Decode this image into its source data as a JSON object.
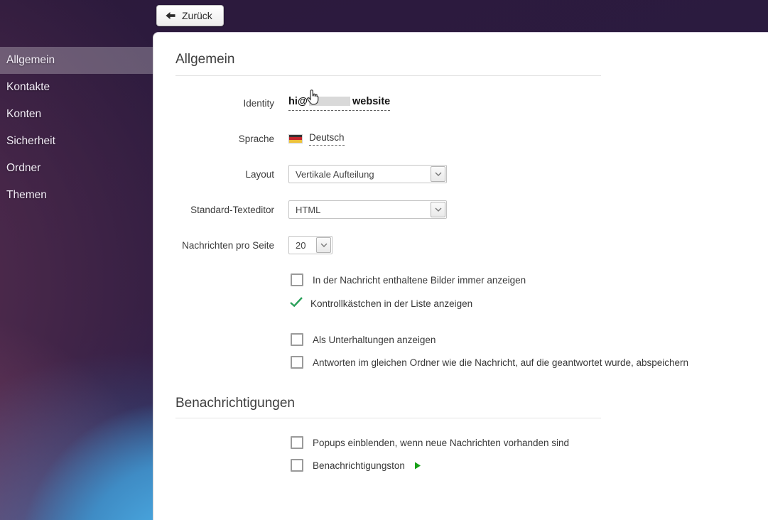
{
  "toolbar": {
    "back_label": "Zurück"
  },
  "icons": {
    "back": "left-arrow",
    "select": "chevron-down",
    "checked": "green-checkmark",
    "play": "green-play-triangle",
    "language_flag": "german-flag",
    "pointer": "hand-cursor"
  },
  "colors": {
    "check_green": "#2aa05a",
    "play_green": "#18a018",
    "sidebar_highlight": "rgba(255,255,255,0.27)",
    "panel_bg": "#ffffff"
  },
  "sidebar": {
    "items": [
      {
        "label": "Allgemein",
        "selected": true
      },
      {
        "label": "Kontakte",
        "selected": false
      },
      {
        "label": "Konten",
        "selected": false
      },
      {
        "label": "Sicherheit",
        "selected": false
      },
      {
        "label": "Ordner",
        "selected": false
      },
      {
        "label": "Themen",
        "selected": false
      }
    ]
  },
  "general": {
    "title": "Allgemein",
    "identity": {
      "label": "Identity",
      "value_prefix": "hi@",
      "value_redacted": true,
      "value_suffix": "website"
    },
    "language": {
      "label": "Sprache",
      "value": "Deutsch"
    },
    "layout": {
      "label": "Layout",
      "value": "Vertikale Aufteilung"
    },
    "editor": {
      "label": "Standard-Texteditor",
      "value": "HTML"
    },
    "per_page": {
      "label": "Nachrichten pro Seite",
      "value": "20"
    },
    "checkboxes": [
      {
        "label": "In der Nachricht enthaltene Bilder immer anzeigen",
        "checked": false
      },
      {
        "label": "Kontrollkästchen in der Liste anzeigen",
        "checked": true
      },
      {
        "label": "Als Unterhaltungen anzeigen",
        "checked": false
      },
      {
        "label": "Antworten im gleichen Ordner wie die Nachricht, auf die geantwortet wurde, abspeichern",
        "checked": false
      }
    ]
  },
  "notifications": {
    "title": "Benachrichtigungen",
    "checkboxes": [
      {
        "label": "Popups einblenden, wenn neue Nachrichten vorhanden sind",
        "checked": false
      },
      {
        "label": "Benachrichtigungston",
        "checked": false,
        "has_play_button": true
      }
    ]
  }
}
